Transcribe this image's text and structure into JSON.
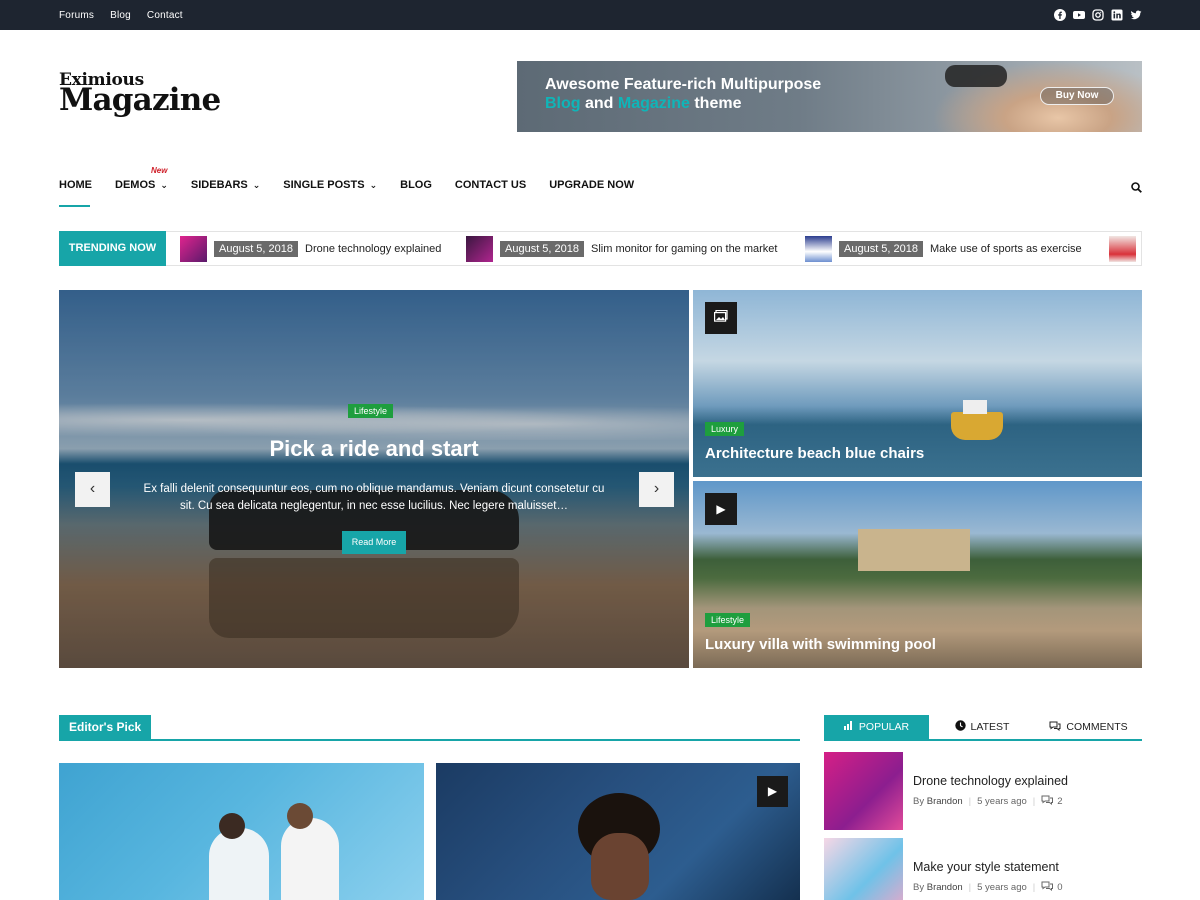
{
  "topbar": {
    "links": [
      "Forums",
      "Blog",
      "Contact"
    ],
    "social_icons": [
      "facebook-icon",
      "youtube-icon",
      "instagram-icon",
      "linkedin-icon",
      "twitter-icon"
    ]
  },
  "logo": {
    "line1": "Eximious",
    "line2": "Magazine"
  },
  "banner": {
    "line1": "Awesome Feature-rich Multipurpose",
    "line2_hl1": "Blog",
    "line2_mid": " and ",
    "line2_hl2": "Magazine",
    "line2_end": " theme",
    "button": "Buy Now"
  },
  "nav": {
    "items": [
      "HOME",
      "DEMOS",
      "SIDEBARS",
      "SINGLE POSTS",
      "BLOG",
      "CONTACT US",
      "UPGRADE NOW"
    ],
    "new_badge": "New"
  },
  "trending": {
    "label": "TRENDING NOW",
    "entries": [
      {
        "date": "August 5, 2018",
        "title": "Drone technology explained"
      },
      {
        "date": "August 5, 2018",
        "title": "Slim monitor for gaming on the market"
      },
      {
        "date": "August 5, 2018",
        "title": "Make use of sports as exercise"
      }
    ]
  },
  "hero": {
    "category": "Lifestyle",
    "title": "Pick a ride and start",
    "excerpt": "Ex falli delenit consequuntur eos, cum no oblique mandamus. Veniam dicunt consetetur cu sit. Cu sea delicata neglegentur, in nec esse lucilius. Nec legere maluisset…",
    "read_more": "Read More"
  },
  "side_posts": [
    {
      "category": "Luxury",
      "title": "Architecture beach blue chairs",
      "media": "gallery-icon"
    },
    {
      "category": "Lifestyle",
      "title": "Luxury villa with swimming pool",
      "media": "play-icon"
    }
  ],
  "editors_pick": {
    "heading": "Editor's Pick"
  },
  "tabs": {
    "popular": "POPULAR",
    "latest": "LATEST",
    "comments": "COMMENTS"
  },
  "popular_posts": [
    {
      "title": "Drone technology explained",
      "by": "By",
      "author": "Brandon",
      "time": "5 years ago",
      "comments": "2"
    },
    {
      "title": "Make your style statement",
      "by": "By",
      "author": "Brandon",
      "time": "5 years ago",
      "comments": "0"
    }
  ],
  "colors": {
    "accent": "#17a5a8",
    "topbar": "#1e2530",
    "tag_green": "#1e9e3e",
    "new_red": "#d0202a"
  }
}
